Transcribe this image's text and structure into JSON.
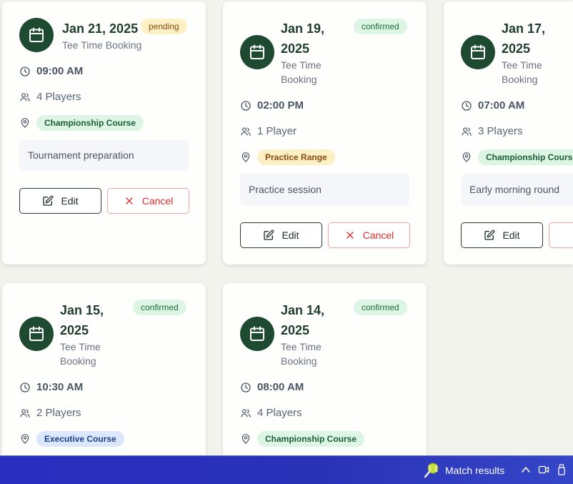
{
  "colors": {
    "accent": "#1f4a32",
    "status_pending_bg": "#fdf0c4",
    "status_confirmed_bg": "#dcf5e5",
    "cancel_red": "#d92d2d",
    "taskbar": "#2a2ec0"
  },
  "icons": {
    "calendar": "calendar-icon",
    "clock": "clock-icon",
    "players": "users-icon",
    "location": "map-pin-icon",
    "edit": "edit-icon",
    "cancel": "x-icon"
  },
  "bookings": [
    {
      "date": "Jan 21, 2025",
      "status": "pending",
      "subtitle": "Tee Time Booking",
      "time": "09:00 AM",
      "players": "4 Players",
      "location": "Championship Course",
      "note": "Tournament preparation",
      "edit_label": "Edit",
      "cancel_label": "Cancel"
    },
    {
      "date_line1": "Jan 19,",
      "date_line2": "2025",
      "status": "confirmed",
      "subtitle_line1": "Tee Time",
      "subtitle_line2": "Booking",
      "time": "02:00 PM",
      "players": "1 Player",
      "location": "Practice Range",
      "note": "Practice session",
      "edit_label": "Edit",
      "cancel_label": "Cancel"
    },
    {
      "date_line1": "Jan 17,",
      "date_line2": "2025",
      "subtitle_line1": "Tee Time",
      "subtitle_line2": "Booking",
      "time": "07:00 AM",
      "players": "3 Players",
      "location": "Championship Course",
      "note": "Early morning round",
      "edit_label": "Edit"
    },
    {
      "date_line1": "Jan 15,",
      "date_line2": "2025",
      "status": "confirmed",
      "subtitle_line1": "Tee Time",
      "subtitle_line2": "Booking",
      "time": "10:30 AM",
      "players": "2 Players",
      "location": "Executive Course"
    },
    {
      "date_line1": "Jan 14,",
      "date_line2": "2025",
      "status": "confirmed",
      "subtitle_line1": "Tee Time",
      "subtitle_line2": "Booking",
      "time": "08:00 AM",
      "players": "4 Players",
      "location": "Championship Course"
    }
  ],
  "taskbar": {
    "widget_label": "Match results"
  }
}
